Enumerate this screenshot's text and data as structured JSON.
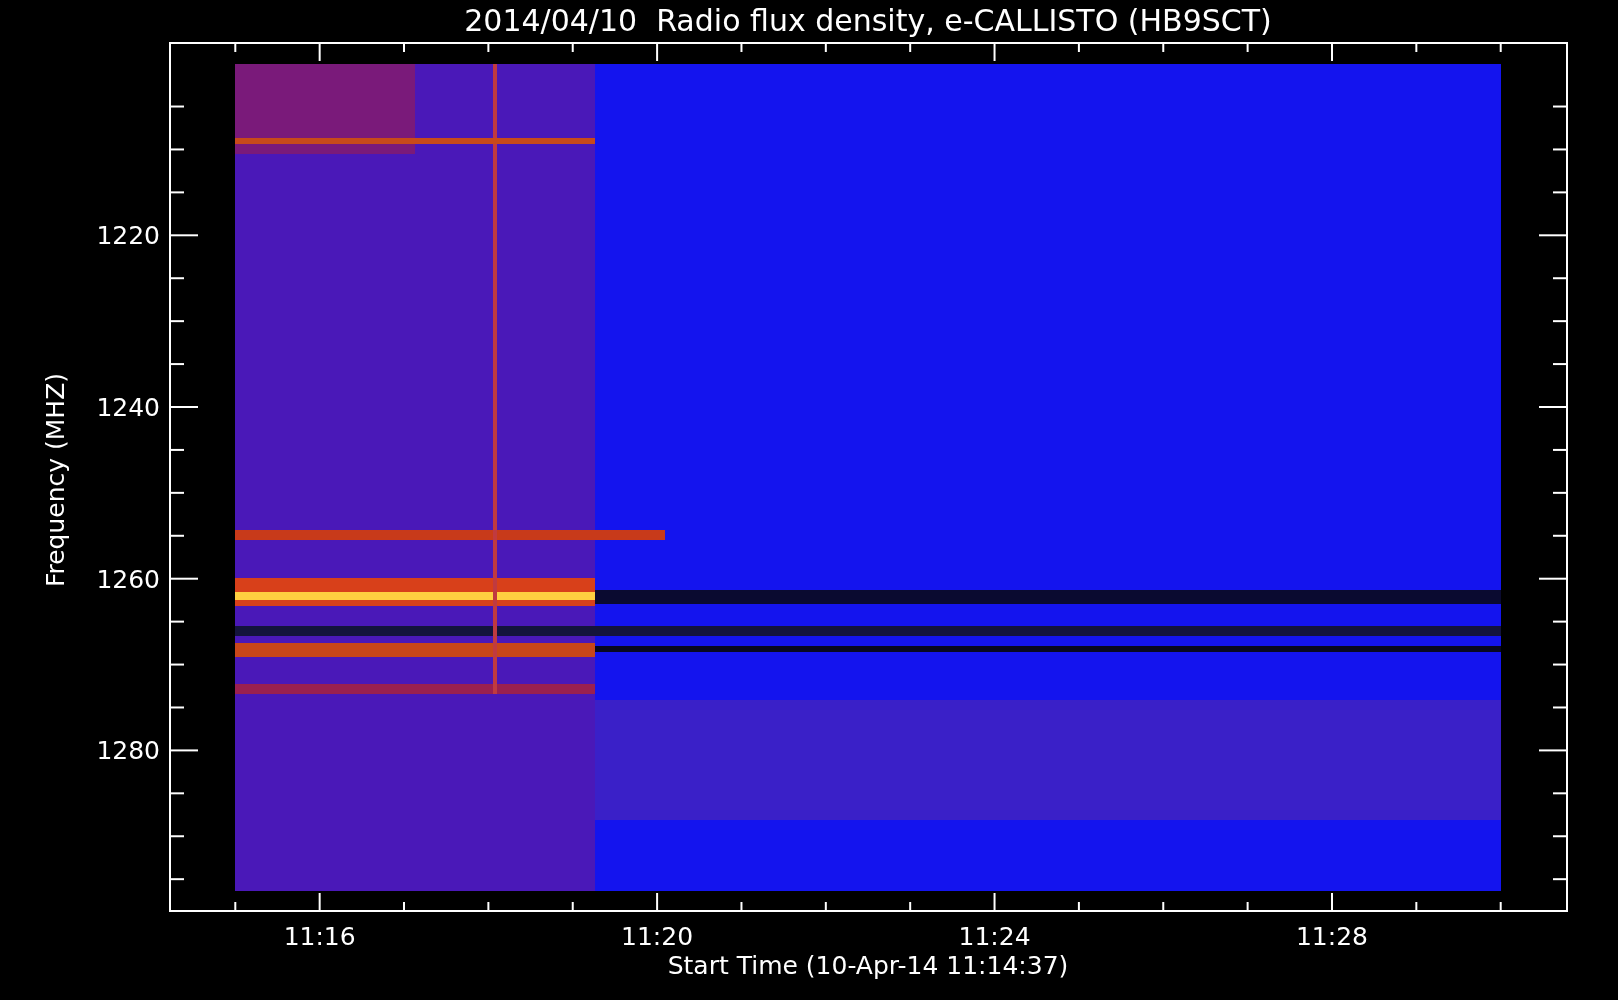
{
  "title": "2014/04/10  Radio flux density, e-CALLISTO (HB9SCT)",
  "y_axis": {
    "label": "Frequency (MHZ)",
    "tick_labels": [
      "1220",
      "1240",
      "1260",
      "1280"
    ]
  },
  "x_axis": {
    "label": "Start Time (10-Apr-14 11:14:37)",
    "tick_labels": [
      "11:16",
      "11:20",
      "11:24",
      "11:28"
    ]
  }
}
